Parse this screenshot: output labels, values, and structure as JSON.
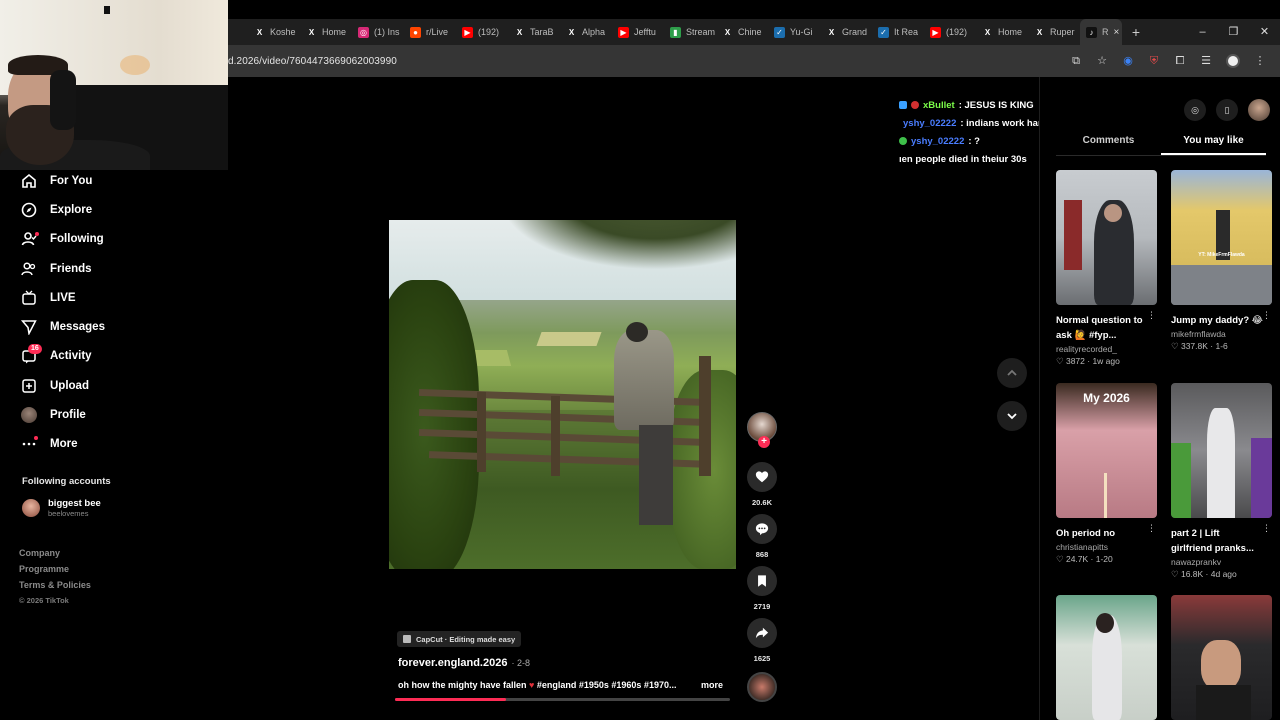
{
  "browser": {
    "tabs": [
      {
        "label": "Koshe",
        "icon": "x-icon",
        "color": "#1f1f1f"
      },
      {
        "label": "Home",
        "icon": "x-icon",
        "color": "#1f1f1f"
      },
      {
        "label": "(1) Ins",
        "icon": "instagram-icon",
        "color": "#d62976"
      },
      {
        "label": "r/Live",
        "icon": "reddit-icon",
        "color": "#ff4500"
      },
      {
        "label": "(192)",
        "icon": "youtube-icon",
        "color": "#ff0000"
      },
      {
        "label": "TaraB",
        "icon": "x-icon",
        "color": "#1f1f1f"
      },
      {
        "label": "Alpha",
        "icon": "x-icon",
        "color": "#1f1f1f"
      },
      {
        "label": "Jefftu",
        "icon": "youtube-icon",
        "color": "#ff0000"
      },
      {
        "label": "Stream",
        "icon": "chart-icon",
        "color": "#2e9e4a"
      },
      {
        "label": "Chine",
        "icon": "x-icon",
        "color": "#1f1f1f"
      },
      {
        "label": "Yu-Gi",
        "icon": "steam-icon",
        "color": "#1b6dad"
      },
      {
        "label": "Grand",
        "icon": "x-icon",
        "color": "#1f1f1f"
      },
      {
        "label": "It Rea",
        "icon": "steam-icon",
        "color": "#1b6dad"
      },
      {
        "label": "(192)",
        "icon": "youtube-icon",
        "color": "#ff0000"
      },
      {
        "label": "Home",
        "icon": "x-icon",
        "color": "#1f1f1f"
      },
      {
        "label": "Ruper",
        "icon": "x-icon",
        "color": "#1f1f1f"
      }
    ],
    "active_tab": {
      "label": "R",
      "icon": "tiktok-icon"
    },
    "url": "d.2026/video/7604473669062003990"
  },
  "nav": {
    "items": [
      {
        "label": "For You",
        "icon": "home-icon"
      },
      {
        "label": "Explore",
        "icon": "compass-icon"
      },
      {
        "label": "Following",
        "icon": "following-icon"
      },
      {
        "label": "Friends",
        "icon": "friends-icon"
      },
      {
        "label": "LIVE",
        "icon": "live-icon"
      },
      {
        "label": "Messages",
        "icon": "messages-icon"
      },
      {
        "label": "Activity",
        "icon": "activity-icon",
        "badge": "16"
      },
      {
        "label": "Upload",
        "icon": "upload-icon"
      },
      {
        "label": "Profile",
        "icon": "profile-avatar"
      },
      {
        "label": "More",
        "icon": "more-icon"
      }
    ],
    "following_title": "Following accounts",
    "following": [
      {
        "name": "biggest bee",
        "handle": "beelovemes"
      }
    ],
    "footer": [
      "Company",
      "Programme",
      "Terms & Policies"
    ],
    "copyright": "© 2026 TikTok"
  },
  "chat": [
    {
      "user": "xBullet",
      "text": ": JESUS IS KING",
      "user_color": "#7cfc4a"
    },
    {
      "user": "yshy_02222",
      "text": ": indians work hard wdym",
      "user_color": "#4a7dff"
    },
    {
      "user": "yshy_02222",
      "text": ": ?",
      "user_color": "#4a7dff"
    },
    {
      "user": "",
      "text": "ıen people died in theiur 30s",
      "user_color": "#ffffff"
    }
  ],
  "video": {
    "capcut_label": "CapCut · Editing made easy",
    "author": "forever.england.2026",
    "date": "· 2-8",
    "description_start": "oh how the mighty have fallen ",
    "heart": "♥",
    "description_end": " #england #1950s #1960s #1970...",
    "more_label": "more",
    "progress": 0.33,
    "likes": "20.6K",
    "comments": "868",
    "saves": "2719",
    "shares": "1625"
  },
  "panel": {
    "tabs": [
      {
        "label": "Comments"
      },
      {
        "label": "You may like"
      }
    ],
    "active_tab_index": 1,
    "cards": [
      {
        "title": "Normal question to ask 🙋 #fyp...",
        "author": "realityrecorded_",
        "stats": "♡ 3872 · 1w ago"
      },
      {
        "title": "Jump my daddy? 😂",
        "author": "mikefrmflawda",
        "stats": "♡ 337.8K · 1-6"
      },
      {
        "title": "Oh period no",
        "author": "christianapitts",
        "stats": "♡ 24.7K · 1-20"
      },
      {
        "title": "part 2 | Lift girlfriend pranks...",
        "author": "nawazprankv",
        "stats": "♡ 16.8K · 4d ago"
      },
      {
        "title": "",
        "author": "",
        "stats": ""
      },
      {
        "title": "",
        "author": "",
        "stats": ""
      }
    ],
    "thumb_label_3": "My 2026",
    "thumb_label_2": "YT: MikeFrmFlawda"
  }
}
